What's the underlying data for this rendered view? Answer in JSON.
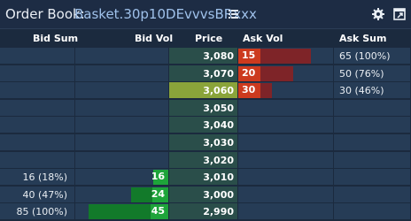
{
  "header": {
    "label": "Order Book:",
    "instrument": "Basket.30p10DEvvvsBRxxx",
    "icons": [
      "list-icon",
      "gear-icon",
      "popout-icon"
    ]
  },
  "columns": {
    "bid_sum": "Bid Sum",
    "bid_vol": "Bid Vol",
    "price": "Price",
    "ask_vol": "Ask Vol",
    "ask_sum": "Ask Sum"
  },
  "colors": {
    "bid_solid": "#1ea43a",
    "bid_light": "#127a2a",
    "ask_solid": "#cc3a1e",
    "ask_light": "#7e2428",
    "price_highlight": "#8aa43a",
    "price_column": "#2a4e4a"
  },
  "rows": [
    {
      "price": "3,080",
      "ask_vol": "15",
      "ask_sum": "65 (100%)",
      "ask_level": 1.0,
      "bid_vol": "",
      "bid_sum": "",
      "bid_level": 0
    },
    {
      "price": "3,070",
      "ask_vol": "20",
      "ask_sum": "50 (76%)",
      "ask_level": 0.76,
      "bid_vol": "",
      "bid_sum": "",
      "bid_level": 0
    },
    {
      "price": "3,060",
      "ask_vol": "30",
      "ask_sum": "30 (46%)",
      "ask_level": 0.46,
      "bid_vol": "",
      "bid_sum": "",
      "bid_level": 0,
      "highlight": true
    },
    {
      "price": "3,050",
      "ask_vol": "",
      "ask_sum": "",
      "ask_level": 0,
      "bid_vol": "",
      "bid_sum": "",
      "bid_level": 0
    },
    {
      "price": "3,040",
      "ask_vol": "",
      "ask_sum": "",
      "ask_level": 0,
      "bid_vol": "",
      "bid_sum": "",
      "bid_level": 0
    },
    {
      "price": "3,030",
      "ask_vol": "",
      "ask_sum": "",
      "ask_level": 0,
      "bid_vol": "",
      "bid_sum": "",
      "bid_level": 0
    },
    {
      "price": "3,020",
      "ask_vol": "",
      "ask_sum": "",
      "ask_level": 0,
      "bid_vol": "",
      "bid_sum": "",
      "bid_level": 0
    },
    {
      "price": "3,010",
      "ask_vol": "",
      "ask_sum": "",
      "ask_level": 0,
      "bid_vol": "16",
      "bid_sum": "16 (18%)",
      "bid_level": 0.18
    },
    {
      "price": "3,000",
      "ask_vol": "",
      "ask_sum": "",
      "ask_level": 0,
      "bid_vol": "24",
      "bid_sum": "40 (47%)",
      "bid_level": 0.47
    },
    {
      "price": "2,990",
      "ask_vol": "",
      "ask_sum": "",
      "ask_level": 0,
      "bid_vol": "45",
      "bid_sum": "85 (100%)",
      "bid_level": 1.0
    }
  ]
}
